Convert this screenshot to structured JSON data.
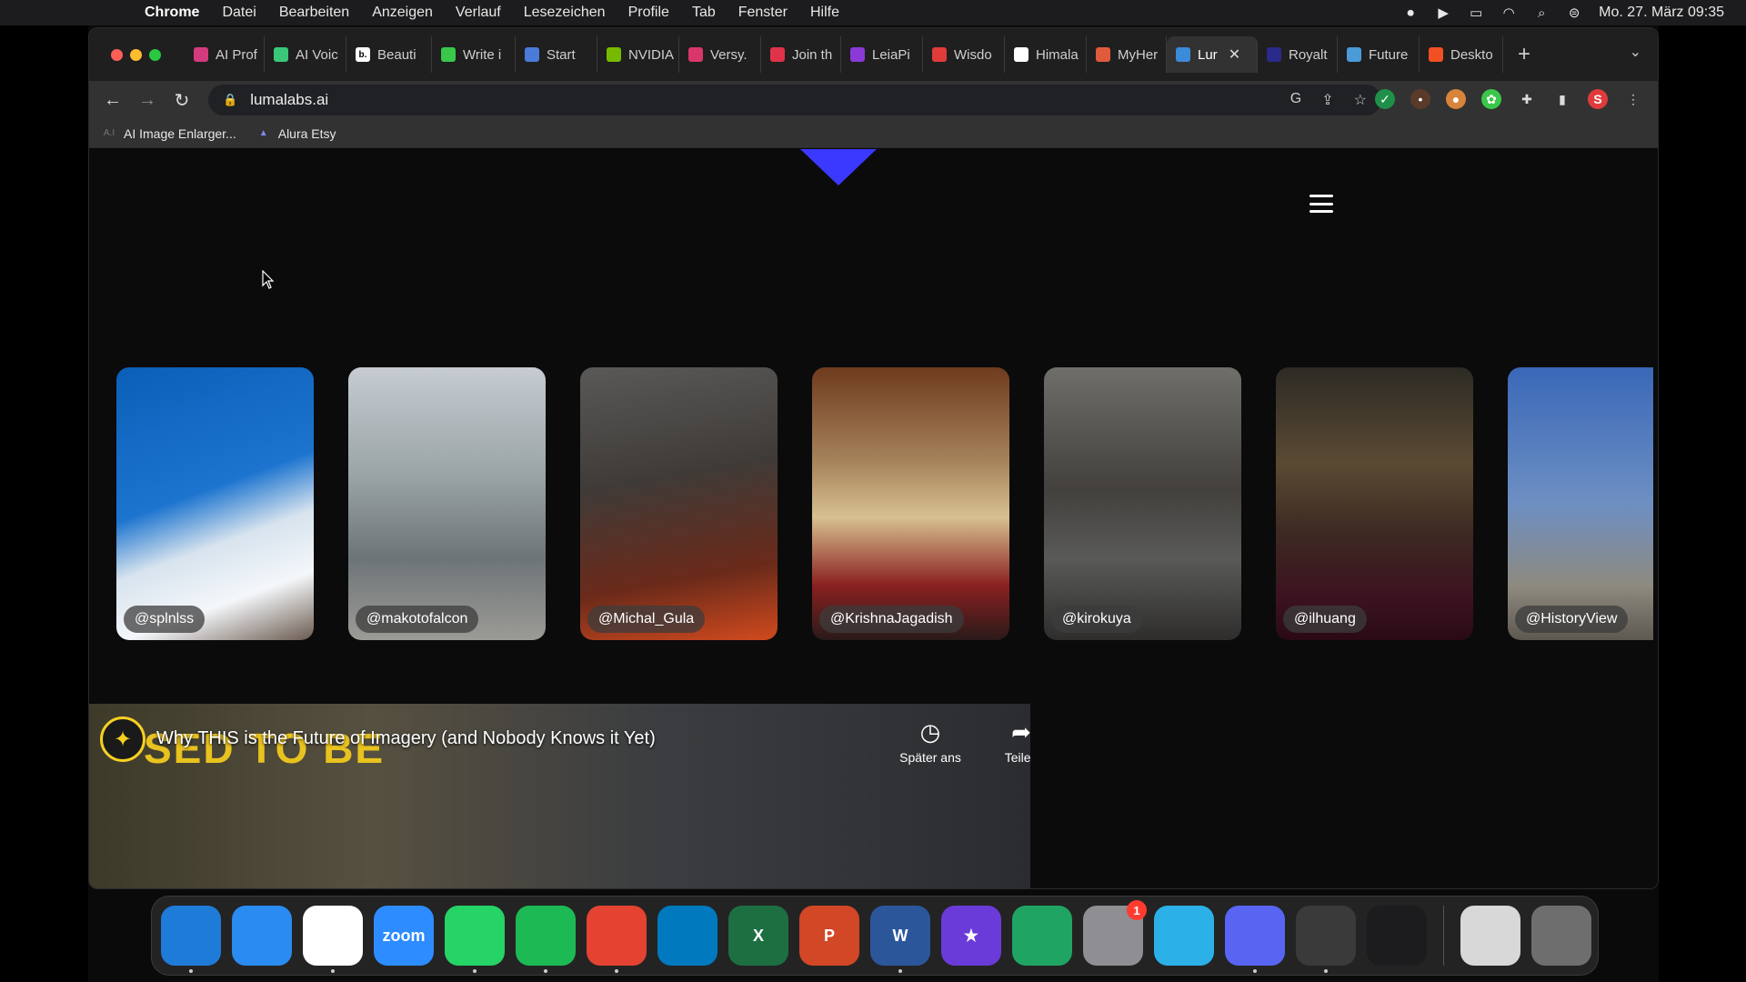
{
  "menubar": {
    "app_name": "Chrome",
    "menus": [
      "Datei",
      "Bearbeiten",
      "Anzeigen",
      "Verlauf",
      "Lesezeichen",
      "Profile",
      "Tab",
      "Fenster",
      "Hilfe"
    ],
    "datetime": "Mo. 27. März  09:35"
  },
  "tabs": [
    {
      "label": "AI Prof",
      "color": "#d33b7d"
    },
    {
      "label": "AI Voic",
      "color": "#3ac77a"
    },
    {
      "label": "Beauti",
      "color": "#ffffff",
      "icon_text": "b."
    },
    {
      "label": "Write i",
      "color": "#3ac74a"
    },
    {
      "label": "Start",
      "color": "#4a7bd8"
    },
    {
      "label": "NVIDIA",
      "color": "#76b900"
    },
    {
      "label": "Versy.",
      "color": "#d9366b"
    },
    {
      "label": "Join th",
      "color": "#e0334a"
    },
    {
      "label": "LeiaPi",
      "color": "#8b3ad8"
    },
    {
      "label": "Wisdo",
      "color": "#e03b3b"
    },
    {
      "label": "Himala",
      "color": "#ffffff"
    },
    {
      "label": "MyHer",
      "color": "#e05a3b"
    },
    {
      "label": "Lur",
      "color": "#3b8bd8",
      "active": true
    },
    {
      "label": "Royalt",
      "color": "#2a2a8a"
    },
    {
      "label": "Future",
      "color": "#4a9bd8"
    },
    {
      "label": "Deskto",
      "color": "#f25022"
    }
  ],
  "url": "lumalabs.ai",
  "bookmarks": [
    {
      "label": "AI Image Enlarger..."
    },
    {
      "label": "Alura Etsy"
    }
  ],
  "gallery": [
    {
      "user": "@splnlss"
    },
    {
      "user": "@makotofalcon"
    },
    {
      "user": "@Michal_Gula"
    },
    {
      "user": "@KrishnaJagadish"
    },
    {
      "user": "@kirokuya"
    },
    {
      "user": "@ilhuang"
    },
    {
      "user": "@HistoryView"
    }
  ],
  "video": {
    "overlay_text": "SED TO BE",
    "title": "Why THIS is the Future of Imagery (and Nobody Knows it Yet)",
    "watch_later": "Später ans",
    "share": "Teilen"
  },
  "dock": [
    {
      "name": "finder",
      "label": "",
      "color": "#1e7bd8"
    },
    {
      "name": "safari",
      "label": "",
      "color": "#2a8bf0"
    },
    {
      "name": "chrome",
      "label": "",
      "color": "#ffffff"
    },
    {
      "name": "zoom",
      "label": "zoom",
      "color": "#2d8cff"
    },
    {
      "name": "whatsapp",
      "label": "",
      "color": "#25d366"
    },
    {
      "name": "spotify",
      "label": "",
      "color": "#1db954"
    },
    {
      "name": "todoist",
      "label": "",
      "color": "#e44332"
    },
    {
      "name": "trello",
      "label": "",
      "color": "#0079bf"
    },
    {
      "name": "excel",
      "label": "X",
      "color": "#1d6f42"
    },
    {
      "name": "powerpoint",
      "label": "P",
      "color": "#d24726"
    },
    {
      "name": "word",
      "label": "W",
      "color": "#2b579a"
    },
    {
      "name": "imovie",
      "label": "★",
      "color": "#6a3bd8"
    },
    {
      "name": "google-drive",
      "label": "",
      "color": "#1fa463"
    },
    {
      "name": "system-settings",
      "label": "",
      "color": "#8e8e93",
      "badge": "1"
    },
    {
      "name": "app-circle",
      "label": "",
      "color": "#2bb0e8"
    },
    {
      "name": "discord",
      "label": "",
      "color": "#5865f2"
    },
    {
      "name": "quicktime",
      "label": "",
      "color": "#3a3a3a"
    },
    {
      "name": "voice-memos",
      "label": "",
      "color": "#1c1c1e"
    },
    {
      "name": "preview-window",
      "label": "",
      "color": "#d8d8d8"
    },
    {
      "name": "trash",
      "label": "",
      "color": "#6e6e6e"
    }
  ]
}
